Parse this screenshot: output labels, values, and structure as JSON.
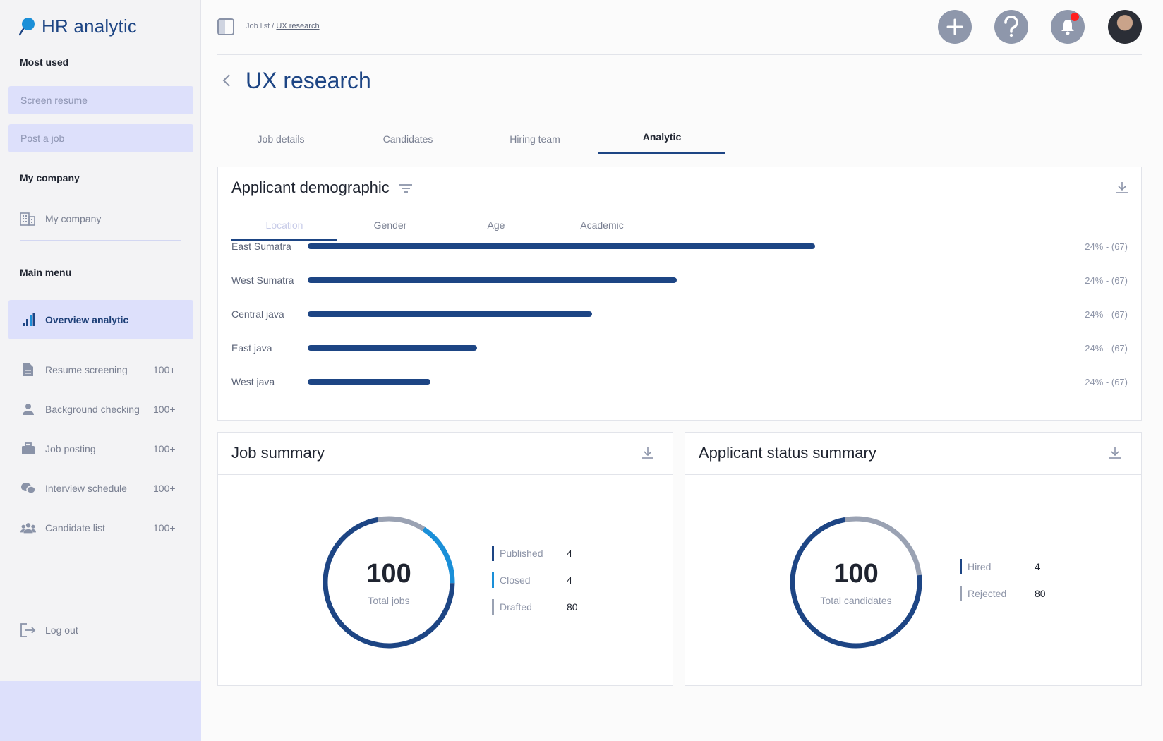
{
  "app": {
    "name": "HR analytic"
  },
  "sidebar": {
    "most_used_label": "Most used",
    "quick_actions": [
      "Screen resume",
      "Post a job"
    ],
    "my_company_label": "My company",
    "my_company_item": "My company",
    "main_menu_label": "Main menu",
    "menu": [
      {
        "label": "Overview analytic",
        "count": "",
        "icon": "bar-chart-icon",
        "active": true
      },
      {
        "label": "Resume screening",
        "count": "100+",
        "icon": "document-icon"
      },
      {
        "label": "Background checking",
        "count": "100+",
        "icon": "person-icon"
      },
      {
        "label": "Job posting",
        "count": "100+",
        "icon": "briefcase-icon"
      },
      {
        "label": "Interview schedule",
        "count": "100+",
        "icon": "chat-icon"
      },
      {
        "label": "Candidate list",
        "count": "100+",
        "icon": "group-icon"
      }
    ],
    "logout_label": "Log out"
  },
  "header": {
    "breadcrumb_parent": "Job list",
    "breadcrumb_sep": " / ",
    "breadcrumb_current": "UX research",
    "actions": [
      "plus-icon",
      "help-icon",
      "bell-icon"
    ],
    "notification_color": "#ff1f1f"
  },
  "page": {
    "title": "UX research",
    "tabs": [
      {
        "label": "Job details"
      },
      {
        "label": "Candidates"
      },
      {
        "label": "Hiring team"
      },
      {
        "label": "Analytic",
        "active": true
      }
    ]
  },
  "demographic": {
    "title": "Applicant demographic",
    "tabs": [
      {
        "label": "Location",
        "active": true
      },
      {
        "label": "Gender"
      },
      {
        "label": "Age"
      },
      {
        "label": "Academic"
      }
    ]
  },
  "chart_data": [
    {
      "type": "bar",
      "orientation": "horizontal",
      "categories": [
        "East Sumatra",
        "West Sumatra",
        "Central java",
        "East java",
        "West java"
      ],
      "values": [
        0.66,
        0.48,
        0.37,
        0.22,
        0.16
      ],
      "value_labels": [
        "24% - (67)",
        "24% - (67)",
        "24% - (67)",
        "24% - (67)",
        "24% - (67)"
      ],
      "bar_color": "#1d4584"
    },
    {
      "type": "pie",
      "title": "Job summary",
      "center_value": "100",
      "center_label": "Total jobs",
      "legend": [
        {
          "label": "Published",
          "value": 4,
          "color": "#1d4584"
        },
        {
          "label": "Closed",
          "value": 4,
          "color": "#1a8fd8"
        },
        {
          "label": "Drafted",
          "value": 80,
          "color": "#9aa2b3"
        }
      ],
      "arc_fractions": [
        0.72,
        0.16,
        0.12
      ]
    },
    {
      "type": "pie",
      "title": "Applicant status summary",
      "center_value": "100",
      "center_label": "Total candidates",
      "legend": [
        {
          "label": "Hired",
          "value": 4,
          "color": "#1d4584"
        },
        {
          "label": "Rejected",
          "value": 80,
          "color": "#9aa2b3"
        }
      ],
      "arc_fractions": [
        0.74,
        0.26
      ]
    }
  ],
  "colors": {
    "accent": "#1d4584",
    "sidebar_highlight": "#dde0fb",
    "muted_text": "#7a8092"
  }
}
